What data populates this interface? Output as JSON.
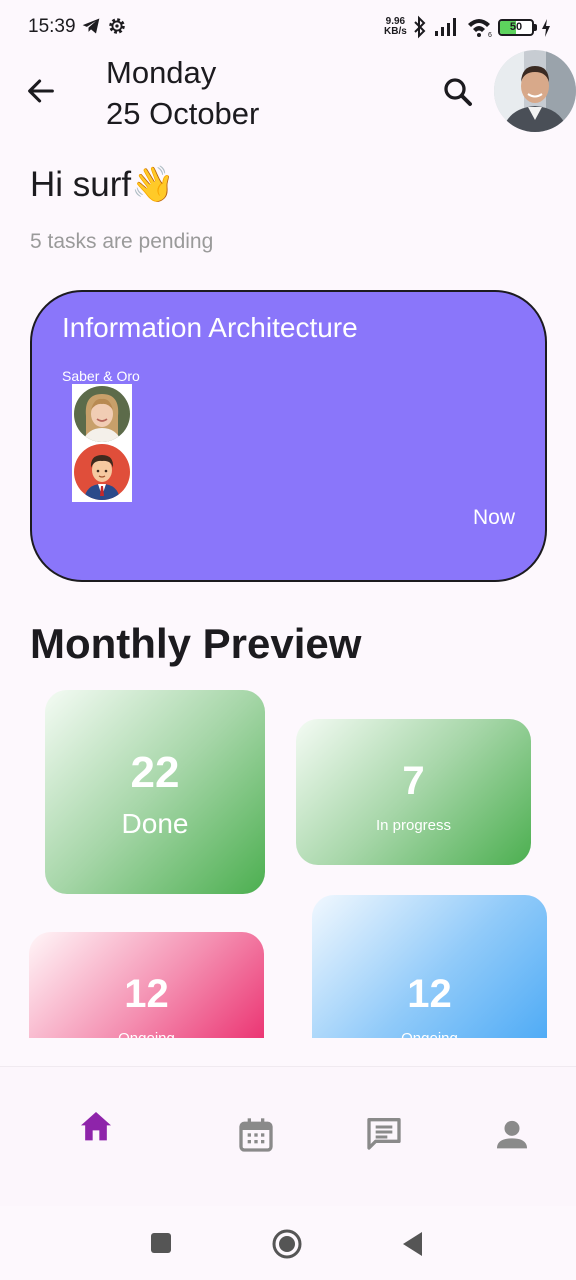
{
  "status_bar": {
    "time": "15:39",
    "net_speed_value": "9.96",
    "net_speed_unit": "KB/s",
    "battery_level": "50",
    "icons": [
      "telegram-icon",
      "settings-icon",
      "bluetooth-icon",
      "signal-icon",
      "wifi-icon",
      "battery-icon",
      "charging-icon"
    ]
  },
  "header": {
    "weekday": "Monday",
    "date": "25 October",
    "back_icon": "arrow-back-icon",
    "search_icon": "search-icon"
  },
  "greeting": {
    "text": "Hi surf👋",
    "pending": "5 tasks are pending"
  },
  "task_card": {
    "title": "Information Architecture",
    "members": "Saber & Oro",
    "time": "Now",
    "color": "#8a76fa"
  },
  "monthly_preview": {
    "title": "Monthly Preview",
    "cards": [
      {
        "value": "22",
        "label": "Done",
        "color": "green"
      },
      {
        "value": "7",
        "label": "In progress",
        "color": "green"
      },
      {
        "value": "12",
        "label": "Ongoing",
        "color": "pink"
      },
      {
        "value": "12",
        "label": "Ongoing",
        "color": "blue"
      }
    ]
  },
  "bottom_nav": {
    "active_color": "#8e24aa",
    "inactive_color": "#8a8a8a",
    "items": [
      "home-icon",
      "calendar-icon",
      "chat-icon",
      "person-icon"
    ]
  },
  "system_nav": [
    "recents-button",
    "home-button",
    "back-button"
  ]
}
